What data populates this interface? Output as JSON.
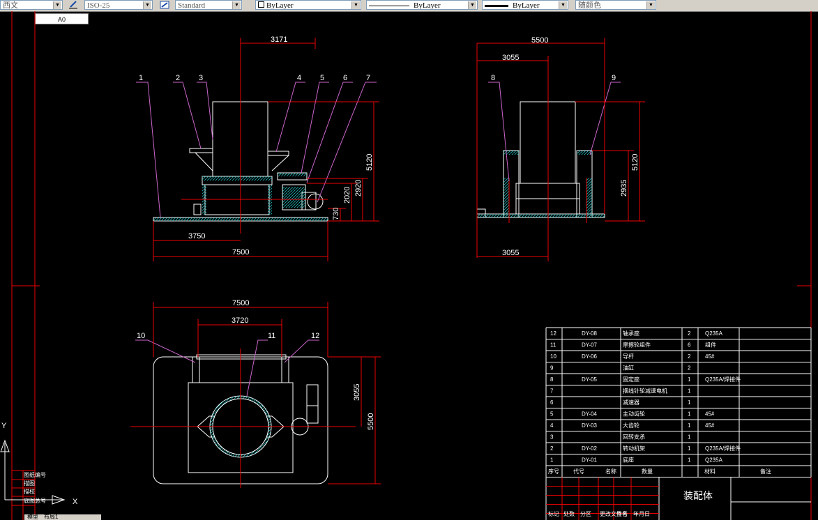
{
  "toolbar": {
    "text_style": "西文",
    "dim_style": "ISO-25",
    "table_style": "Standard",
    "layer": "ByLayer",
    "linetype": "ByLayer",
    "lineweight": "ByLayer",
    "plot_color": "随颜色"
  },
  "layout_tab": "A0",
  "dims": {
    "front_top": "3171",
    "front_5120": "5120",
    "front_2920": "2920",
    "front_2020": "2020",
    "front_730": "730",
    "front_3750": "3750",
    "front_7500": "7500",
    "side_5500": "5500",
    "side_3055_top": "3055",
    "side_5120": "5120",
    "side_2935": "2935",
    "side_3055_bottom": "3055",
    "plan_7500": "7500",
    "plan_3720": "3720",
    "plan_3055": "3055",
    "plan_5500": "5500"
  },
  "balloons": [
    "1",
    "2",
    "3",
    "4",
    "5",
    "6",
    "7",
    "8",
    "9",
    "10",
    "11",
    "12"
  ],
  "ucs": {
    "y": "Y",
    "x": "X"
  },
  "bom": {
    "rows": [
      {
        "no": "12",
        "code": "DY-08",
        "name": "轴承座",
        "qty": "2",
        "mat": "Q235A"
      },
      {
        "no": "11",
        "code": "DY-07",
        "name": "摩擦轮组件",
        "qty": "6",
        "mat": "组件"
      },
      {
        "no": "10",
        "code": "DY-06",
        "name": "导杆",
        "qty": "2",
        "mat": "45#"
      },
      {
        "no": "9",
        "code": "",
        "name": "油缸",
        "qty": "2",
        "mat": ""
      },
      {
        "no": "8",
        "code": "DY-05",
        "name": "固定座",
        "qty": "1",
        "mat": "Q235A/焊接件"
      },
      {
        "no": "7",
        "code": "",
        "name": "摆线针轮减速电机",
        "qty": "1",
        "mat": ""
      },
      {
        "no": "6",
        "code": "",
        "name": "减速器",
        "qty": "1",
        "mat": ""
      },
      {
        "no": "5",
        "code": "DY-04",
        "name": "主动齿轮",
        "qty": "1",
        "mat": "45#"
      },
      {
        "no": "4",
        "code": "DY-03",
        "name": "大齿轮",
        "qty": "1",
        "mat": "45#"
      },
      {
        "no": "3",
        "code": "",
        "name": "回转支承",
        "qty": "1",
        "mat": ""
      },
      {
        "no": "2",
        "code": "DY-02",
        "name": "转动机架",
        "qty": "1",
        "mat": "Q235A/焊接件"
      },
      {
        "no": "1",
        "code": "DY-01",
        "name": "底座",
        "qty": "1",
        "mat": "Q235A"
      }
    ],
    "header": [
      "序号",
      "代号",
      "名称",
      "数量",
      "材料",
      "备注"
    ],
    "title": "装配体",
    "signoff": [
      "标记",
      "处数",
      "分区",
      "更改文件号",
      "签名",
      "年月日"
    ]
  },
  "left_strip_labels": [
    "图纸编号",
    "描图",
    "描校",
    "底图总号"
  ],
  "model_tabs": [
    "模型",
    "布局1"
  ]
}
